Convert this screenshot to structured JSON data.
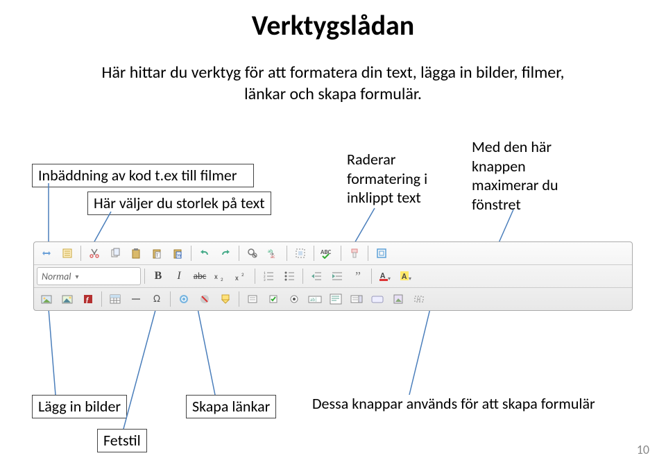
{
  "title": "Verktygslådan",
  "subtitle_line1": "Här hittar du verktyg för att formatera din text, lägga in bilder, filmer,",
  "subtitle_line2": "länkar och skapa formulär.",
  "callouts": {
    "embed": "Inbäddning av kod t.ex till filmer",
    "size": "Här väljer du storlek på text",
    "erase": "Raderar formatering i inklippt text",
    "maximize": "Med den här knappen maximerar du fönstret",
    "images": "Lägg in bilder",
    "bold": "Fetstil",
    "links": "Skapa länkar",
    "forms": "Dessa knappar används för att skapa formulär"
  },
  "combo_label": "Normal",
  "page_number": "10"
}
